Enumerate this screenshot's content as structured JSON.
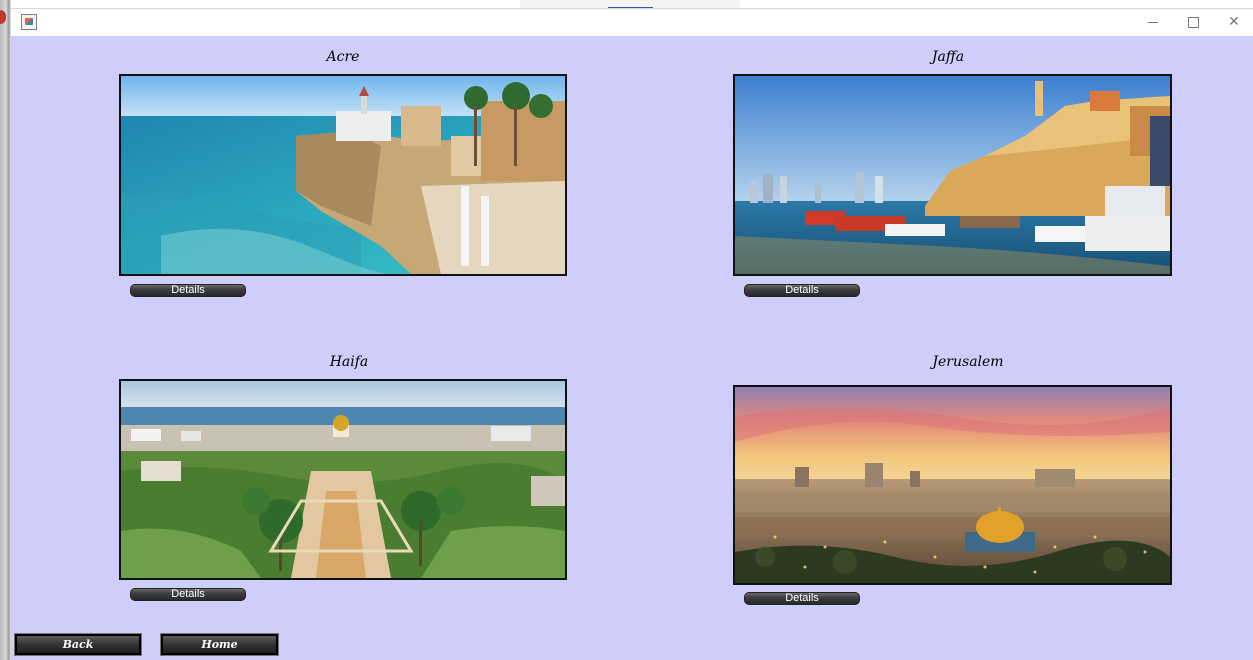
{
  "window": {
    "minimize_glyph": "minimize-icon",
    "maximize_glyph": "maximize-icon",
    "close_symbol": "✕"
  },
  "colors": {
    "panel_background": "#cfcdfa",
    "button_dark": "#2a2a2a",
    "button_text": "#ffffff"
  },
  "cities": [
    {
      "name": "Acre",
      "details_label": "Details",
      "image": "acre-photo"
    },
    {
      "name": "Jaffa",
      "details_label": "Details",
      "image": "jaffa-photo"
    },
    {
      "name": "Haifa",
      "details_label": "Details",
      "image": "haifa-photo"
    },
    {
      "name": "Jerusalem",
      "details_label": "Details",
      "image": "jerusalem-photo"
    }
  ],
  "nav": {
    "back_label": "Back",
    "home_label": "Home"
  }
}
